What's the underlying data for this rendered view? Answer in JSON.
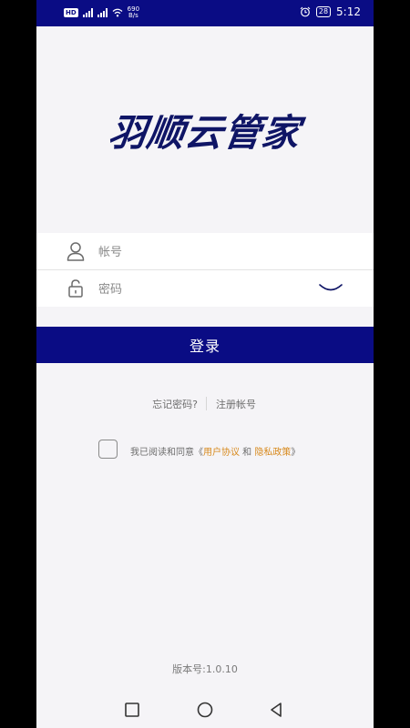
{
  "status_bar": {
    "hd_label": "HD",
    "net_speed_value": "690",
    "net_speed_unit": "B/s",
    "signal_labels": [
      "4G",
      "4G"
    ],
    "battery": "28",
    "time": "5:12"
  },
  "app": {
    "logo_text": "羽顺云管家"
  },
  "form": {
    "account_placeholder": "帐号",
    "password_placeholder": "密码",
    "login_label": "登录"
  },
  "links": {
    "forgot": "忘记密码?",
    "register": "注册帐号"
  },
  "agreement": {
    "prefix": "我已阅读和同意《",
    "user_agreement": "用户协议",
    "and": " 和 ",
    "privacy_policy": "隐私政策",
    "suffix": "》",
    "checked": false
  },
  "version": "版本号:1.0.10",
  "colors": {
    "brand": "#0a0c84",
    "logo": "#0f1566",
    "link_accent": "#d88a1e",
    "background": "#f5f4f7"
  },
  "icons": {
    "account": "user-icon",
    "password": "lock-icon",
    "visibility": "eye-closed-icon",
    "nav": [
      "recent-apps-icon",
      "home-icon",
      "back-icon"
    ]
  }
}
